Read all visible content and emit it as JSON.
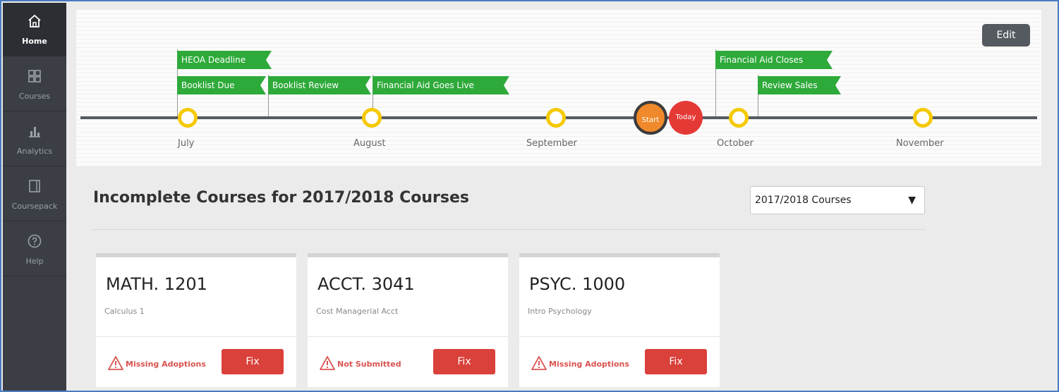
{
  "sidebar": {
    "items": [
      {
        "label": "Home",
        "icon": "home-icon",
        "active": true
      },
      {
        "label": "Courses",
        "icon": "grid-icon",
        "active": false
      },
      {
        "label": "Analytics",
        "icon": "bar-chart-icon",
        "active": false
      },
      {
        "label": "Coursepack",
        "icon": "book-icon",
        "active": false
      },
      {
        "label": "Help",
        "icon": "help-circle-icon",
        "active": false
      }
    ]
  },
  "timeline": {
    "edit_label": "Edit",
    "flags": [
      {
        "label": "HEOA Deadline"
      },
      {
        "label": "Booklist Due"
      },
      {
        "label": "Booklist Review"
      },
      {
        "label": "Financial Aid Goes Live"
      },
      {
        "label": "Financial Aid Closes"
      },
      {
        "label": "Review Sales"
      }
    ],
    "months": [
      "July",
      "August",
      "September",
      "October",
      "November"
    ],
    "markers": [
      {
        "label": "Start",
        "color": "#f0892b"
      },
      {
        "label": "Today",
        "color": "#e53935"
      }
    ],
    "colors": {
      "flag": "#2eaa3a",
      "dot_ring": "#f5c900",
      "line": "#555a5f"
    }
  },
  "section": {
    "title": "Incomplete Courses for 2017/2018 Courses",
    "select_value": "2017/2018 Courses"
  },
  "cards": [
    {
      "code": "MATH. 1201",
      "name": "Calculus 1",
      "status": "Missing Adoptions",
      "fix_label": "Fix"
    },
    {
      "code": "ACCT. 3041",
      "name": "Cost Managerial Acct",
      "status": "Not Submitted",
      "fix_label": "Fix"
    },
    {
      "code": "PSYC. 1000",
      "name": "Intro Psychology",
      "status": "Missing Adoptions",
      "fix_label": "Fix"
    }
  ],
  "colors": {
    "sidebar": "#3b3f45",
    "fix_button": "#d9413a",
    "warning": "#d9534f",
    "frame_border": "#4a7bbf"
  }
}
